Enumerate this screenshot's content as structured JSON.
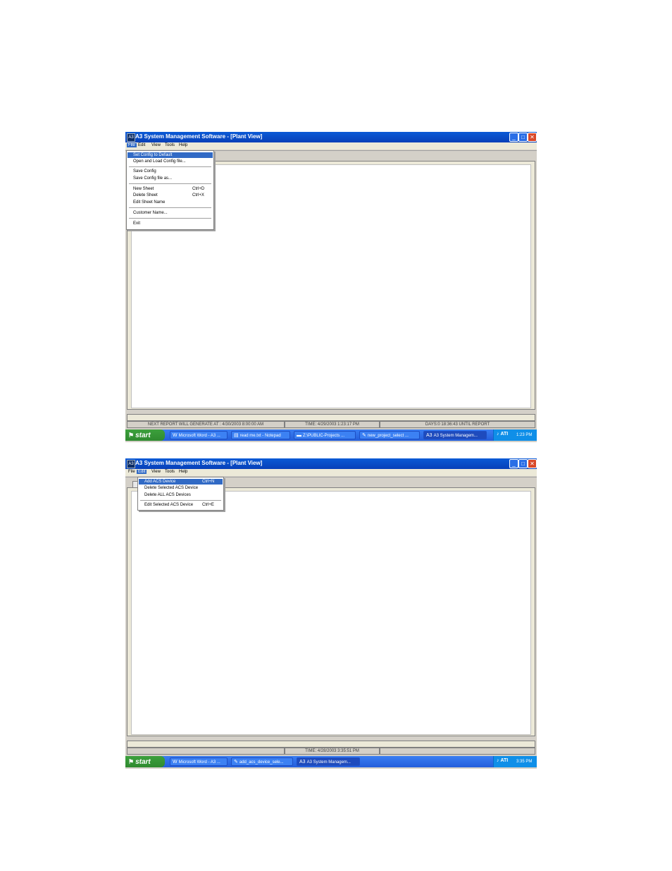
{
  "screenshots": [
    {
      "title": "A3 System Management Software - [Plant View]",
      "app_icon": "A3",
      "menus": [
        "File",
        "Edit",
        "View",
        "Tools",
        "Help"
      ],
      "active_menu": "File",
      "dropdown_items": [
        {
          "label": "Set Config to Default",
          "shortcut": "",
          "highlighted": true
        },
        {
          "label": "Open and Load Config file...",
          "shortcut": ""
        },
        {
          "label": "Save Config",
          "shortcut": ""
        },
        {
          "label": "Save Config file as...",
          "shortcut": ""
        },
        {
          "label": "New Sheet",
          "shortcut": "Ctrl+D"
        },
        {
          "label": "Delete Sheet",
          "shortcut": "Ctrl+X"
        },
        {
          "label": "Edit Sheet Name",
          "shortcut": ""
        },
        {
          "label": "Customer Name...",
          "shortcut": ""
        },
        {
          "label": "Exit",
          "shortcut": ""
        }
      ],
      "status": {
        "next_report": "NEXT REPORT WILL GENERATE AT : 4/30/2003 8:00:00 AM",
        "time": "TIME: 4/29/2003 1:23:17 PM",
        "days": "DAYS:0  18:36:43 UNTIL REPORT"
      },
      "taskbar": {
        "start_label": "start",
        "tasks": [
          {
            "icon": "W",
            "label": "Microsoft Word - A3 ..."
          },
          {
            "icon": "▤",
            "label": "read me.txt - Notepad"
          },
          {
            "icon": "▬",
            "label": "Z:\\PUBLIC-Projects ..."
          },
          {
            "icon": "✎",
            "label": "new_project_select ..."
          },
          {
            "icon": "A3",
            "label": "A3 System Managem...",
            "active": true
          }
        ],
        "tray_label": "ATI",
        "clock": "1:23 PM"
      }
    },
    {
      "title": "A3 System Management Software - [Plant View]",
      "app_icon": "A3",
      "menus": [
        "File",
        "Edit",
        "View",
        "Tools",
        "Help"
      ],
      "active_menu": "Edit",
      "dropdown_items": [
        {
          "label": "Add ACS Device",
          "shortcut": "Ctrl+N",
          "highlighted": true
        },
        {
          "label": "Delete Selected ACS Device",
          "shortcut": ""
        },
        {
          "label": "Delete ALL ACS Devices",
          "shortcut": ""
        },
        {
          "label": "Edit Selected ACS Device",
          "shortcut": "Ctrl+E"
        }
      ],
      "status": {
        "next_report": "",
        "time": "TIME: 4/28/2003 3:35:51 PM",
        "days": ""
      },
      "taskbar": {
        "start_label": "start",
        "tasks": [
          {
            "icon": "W",
            "label": "Microsoft Word - A3 ..."
          },
          {
            "icon": "✎",
            "label": "add_acs_device_sele..."
          },
          {
            "icon": "A3",
            "label": "A3 System Managem...",
            "active": true
          }
        ],
        "tray_label": "ATI",
        "clock": "3:35 PM"
      }
    }
  ]
}
